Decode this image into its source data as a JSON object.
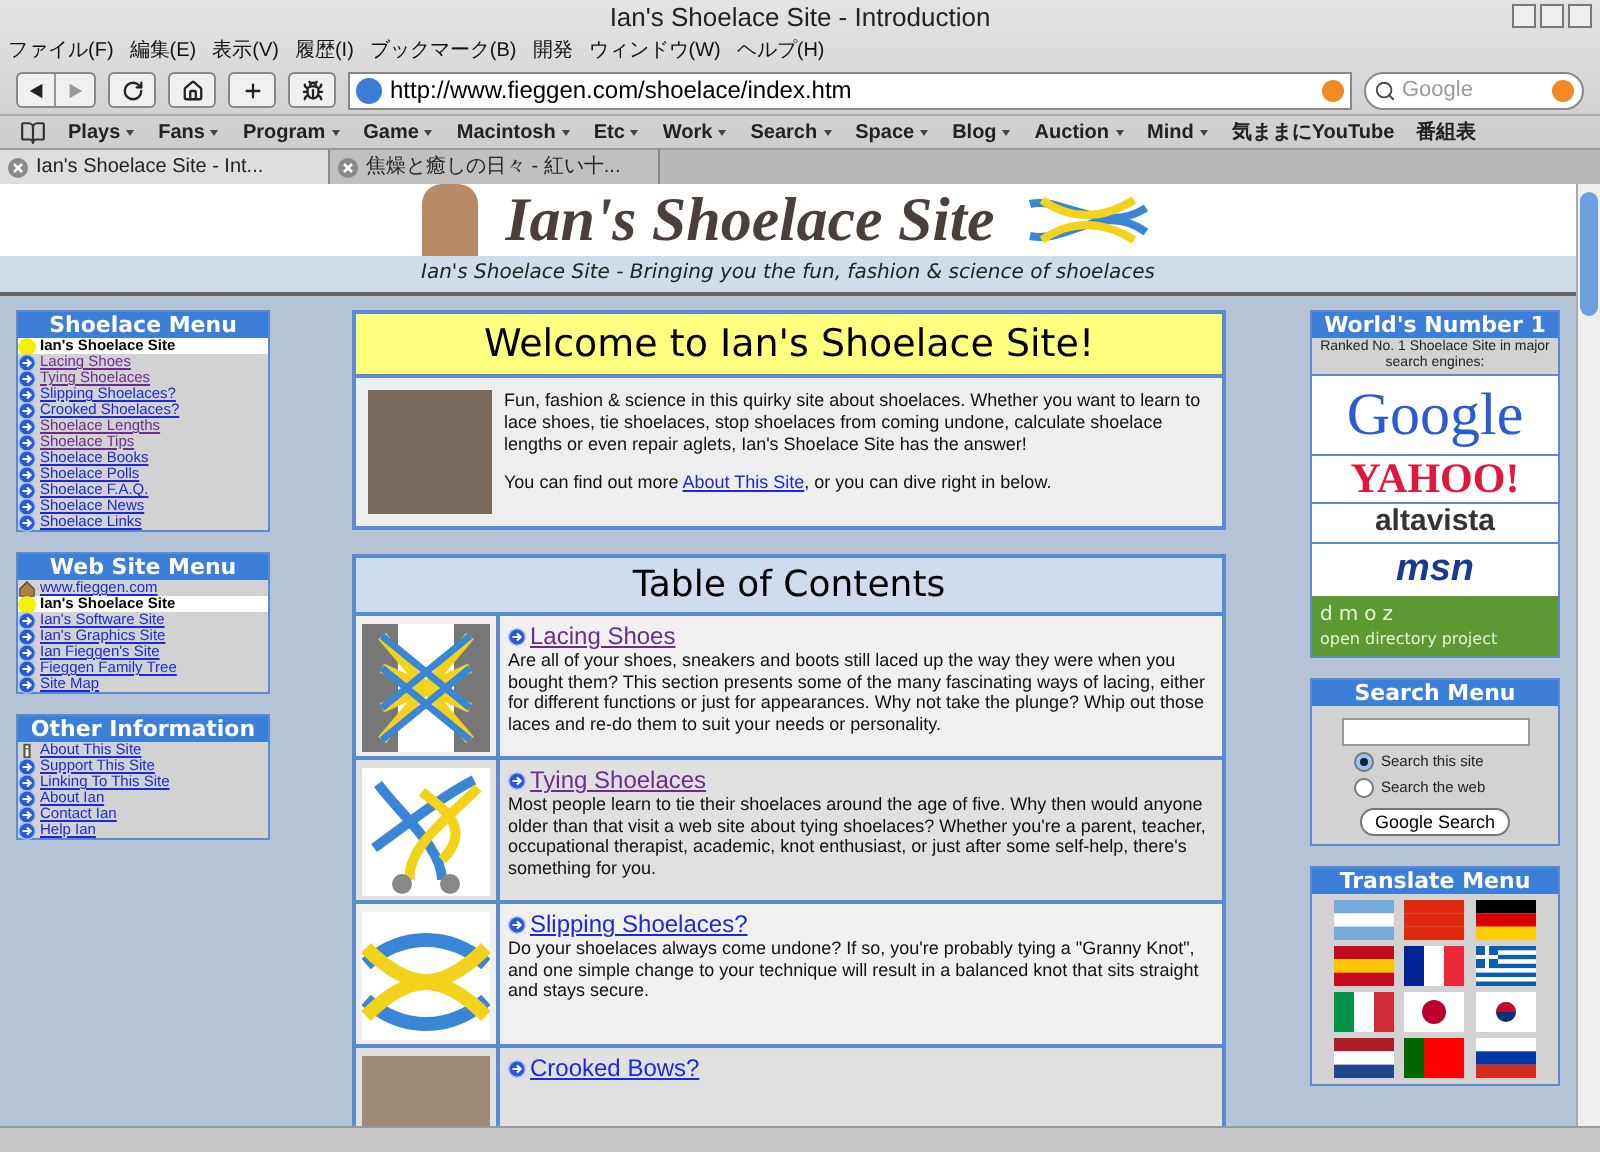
{
  "window": {
    "title": "Ian's Shoelace Site - Introduction"
  },
  "menu_bar": [
    "ファイル(F)",
    "編集(E)",
    "表示(V)",
    "履歴(I)",
    "ブックマーク(B)",
    "開発",
    "ウィンドウ(W)",
    "ヘルプ(H)"
  ],
  "toolbar": {
    "url": "http://www.fieggen.com/shoelace/index.htm",
    "search_placeholder": "Google"
  },
  "bookmarks": [
    {
      "label": "Plays",
      "kind": "folder"
    },
    {
      "label": "Fans",
      "kind": "folder"
    },
    {
      "label": "Program",
      "kind": "folder"
    },
    {
      "label": "Game",
      "kind": "folder"
    },
    {
      "label": "Macintosh",
      "kind": "folder"
    },
    {
      "label": "Etc",
      "kind": "folder"
    },
    {
      "label": "Work",
      "kind": "folder"
    },
    {
      "label": "Search",
      "kind": "folder"
    },
    {
      "label": "Space",
      "kind": "folder"
    },
    {
      "label": "Blog",
      "kind": "folder"
    },
    {
      "label": "Auction",
      "kind": "folder"
    },
    {
      "label": "Mind",
      "kind": "folder"
    },
    {
      "label": "気ままにYouTube",
      "kind": "link"
    },
    {
      "label": "番組表",
      "kind": "link"
    }
  ],
  "tabs": [
    {
      "label": "Ian's Shoelace Site - Int...",
      "selected": true
    },
    {
      "label": "焦燥と癒しの日々 - 紅い十...",
      "selected": false
    }
  ],
  "header": {
    "logo": "Ian's Shoelace Site",
    "tagline": "Ian's Shoelace Site - Bringing you the fun, fashion & science of shoelaces"
  },
  "left_menus": [
    {
      "title": "Shoelace Menu",
      "items": [
        {
          "label": "Ian's Shoelace Site",
          "kind": "current"
        },
        {
          "label": "Lacing Shoes",
          "kind": "link",
          "visited": true
        },
        {
          "label": "Tying Shoelaces",
          "kind": "link",
          "visited": true
        },
        {
          "label": "Slipping Shoelaces?",
          "kind": "link",
          "visited": false
        },
        {
          "label": "Crooked Shoelaces?",
          "kind": "link",
          "visited": false
        },
        {
          "label": "Shoelace Lengths",
          "kind": "link",
          "visited": true
        },
        {
          "label": "Shoelace Tips",
          "kind": "link",
          "visited": true
        },
        {
          "label": "Shoelace Books",
          "kind": "link",
          "visited": false
        },
        {
          "label": "Shoelace Polls",
          "kind": "link",
          "visited": false
        },
        {
          "label": "Shoelace F.A.Q.",
          "kind": "link",
          "visited": false
        },
        {
          "label": "Shoelace News",
          "kind": "link",
          "visited": false
        },
        {
          "label": "Shoelace Links",
          "kind": "link",
          "visited": false
        }
      ]
    },
    {
      "title": "Web Site Menu",
      "items": [
        {
          "label": "www.fieggen.com",
          "kind": "home",
          "visited": false
        },
        {
          "label": "Ian's Shoelace Site",
          "kind": "current"
        },
        {
          "label": "Ian's Software Site",
          "kind": "link",
          "visited": false
        },
        {
          "label": "Ian's Graphics Site",
          "kind": "link",
          "visited": false
        },
        {
          "label": "Ian Fieggen's Site",
          "kind": "link",
          "visited": false
        },
        {
          "label": "Fieggen Family Tree",
          "kind": "link",
          "visited": false
        },
        {
          "label": "Site Map",
          "kind": "link",
          "visited": false
        }
      ]
    },
    {
      "title": "Other Information",
      "items": [
        {
          "label": "About This Site",
          "kind": "info",
          "visited": false
        },
        {
          "label": "Support This Site",
          "kind": "link",
          "visited": false
        },
        {
          "label": "Linking To This Site",
          "kind": "link",
          "visited": false
        },
        {
          "label": "About Ian",
          "kind": "link",
          "visited": false
        },
        {
          "label": "Contact Ian",
          "kind": "link",
          "visited": false
        },
        {
          "label": "Help Ian",
          "kind": "link",
          "visited": false
        }
      ]
    }
  ],
  "welcome": {
    "title": "Welcome to Ian's Shoelace Site!",
    "paragraph": "Fun, fashion & science in this quirky site about shoelaces. Whether you want to learn to lace shoes, tie shoelaces, stop shoelaces from coming undone, calculate shoelace lengths or even repair aglets, Ian's Shoelace Site has the answer!",
    "more_before": "You can find out more",
    "more_link": "About This Site",
    "more_after": ", or you can dive right in below."
  },
  "contents": {
    "title": "Table of Contents",
    "items": [
      {
        "title": "Lacing Shoes",
        "visited": true,
        "kind": "lacing",
        "text": "Are all of your shoes, sneakers and boots still laced up the way they were when you bought them? This section presents some of the many fascinating ways of lacing, either for different functions or just for appearances. Why not take the plunge? Whip out those laces and re-do them to suit your needs or personality."
      },
      {
        "title": "Tying Shoelaces",
        "visited": true,
        "kind": "tying",
        "text": "Most people learn to tie their shoelaces around the age of five. Why then would anyone older than that visit a web site about tying shoelaces? Whether you're a parent, teacher, occupational therapist, academic, knot enthusiast, or just after some self-help, there's something for you."
      },
      {
        "title": "Slipping Shoelaces?",
        "visited": false,
        "kind": "knot",
        "text": "Do your shoelaces always come undone? If so, you're probably tying a \"Granny Knot\", and one simple change to your technique will result in a balanced knot that sits straight and stays secure."
      },
      {
        "title": "Crooked Bows?",
        "visited": false,
        "kind": "photo"
      }
    ]
  },
  "ranking": {
    "title": "World's Number 1",
    "note": "Ranked No. 1 Shoelace Site in major search engines:",
    "engines": [
      {
        "kind": "google",
        "name": "Google"
      },
      {
        "kind": "yahoo",
        "name": "YAHOO!"
      },
      {
        "kind": "altavista",
        "name": "altavista"
      },
      {
        "kind": "msn",
        "name": "msn"
      },
      {
        "kind": "dmoz",
        "name": "dmoz",
        "subtitle": "open directory project"
      }
    ]
  },
  "search_menu": {
    "title": "Search Menu",
    "options": [
      {
        "label": "Search this site",
        "selected": true
      },
      {
        "label": "Search the web",
        "selected": false
      }
    ],
    "button": "Google Search"
  },
  "translate_menu": {
    "title": "Translate Menu"
  }
}
